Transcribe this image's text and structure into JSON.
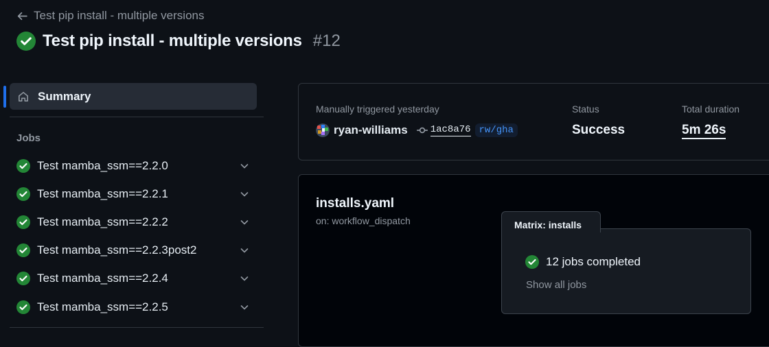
{
  "header": {
    "back_label": "Test pip install - multiple versions",
    "title": "Test pip install - multiple versions",
    "run_number": "#12"
  },
  "sidebar": {
    "summary_label": "Summary",
    "jobs_heading": "Jobs",
    "jobs": [
      {
        "label": "Test mamba_ssm==2.2.0"
      },
      {
        "label": "Test mamba_ssm==2.2.1"
      },
      {
        "label": "Test mamba_ssm==2.2.2"
      },
      {
        "label": "Test mamba_ssm==2.2.3post2"
      },
      {
        "label": "Test mamba_ssm==2.2.4"
      },
      {
        "label": "Test mamba_ssm==2.2.5"
      }
    ]
  },
  "run_info": {
    "trigger": "Manually triggered yesterday",
    "actor": "ryan-williams",
    "commit_sha": "1ac8a76",
    "branch": "rw/gha",
    "status_label": "Status",
    "status_value": "Success",
    "duration_label": "Total duration",
    "duration_value": "5m 26s"
  },
  "graph": {
    "workflow_file": "installs.yaml",
    "workflow_trigger": "on: workflow_dispatch",
    "matrix_title": "Matrix: installs",
    "matrix_status": "12 jobs completed",
    "show_all": "Show all jobs"
  },
  "colors": {
    "background": "#0d1117",
    "success_green": "#238636",
    "accent_blue": "#1f6feb",
    "link_blue": "#4493f8",
    "muted_text": "#9198a1"
  },
  "icons": {
    "back": "arrow-left-icon",
    "status": "check-circle-icon",
    "summary": "home-icon",
    "job_expand": "chevron-down-icon",
    "commit": "git-commit-icon"
  }
}
